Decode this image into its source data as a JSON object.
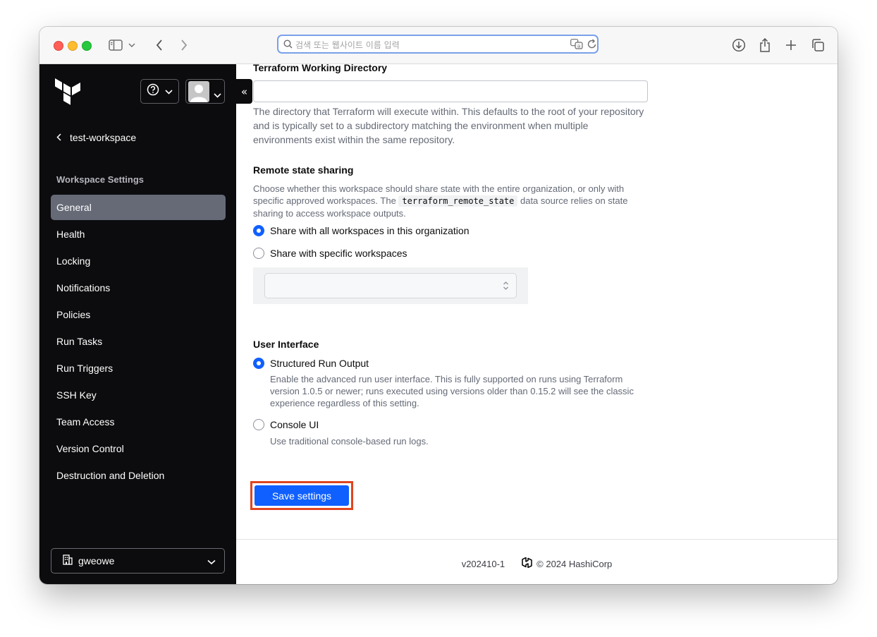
{
  "browser": {
    "url_placeholder": "검색 또는 웹사이트 이름 입력",
    "icons": [
      "sidebar-toggle-icon",
      "chevron-down-icon",
      "back-arrow-icon",
      "forward-arrow-icon",
      "search-icon",
      "translate-icon",
      "reload-icon",
      "download-icon",
      "share-icon",
      "new-tab-icon",
      "tab-overview-icon"
    ]
  },
  "sidebar": {
    "collapse_label": "«",
    "back_label": "test-workspace",
    "section_title": "Workspace Settings",
    "items": [
      {
        "label": "General",
        "active": true
      },
      {
        "label": "Health"
      },
      {
        "label": "Locking"
      },
      {
        "label": "Notifications"
      },
      {
        "label": "Policies"
      },
      {
        "label": "Run Tasks"
      },
      {
        "label": "Run Triggers"
      },
      {
        "label": "SSH Key"
      },
      {
        "label": "Team Access"
      },
      {
        "label": "Version Control"
      },
      {
        "label": "Destruction and Deletion"
      }
    ],
    "org_name": "gweowe"
  },
  "main": {
    "working_dir": {
      "label": "Terraform Working Directory",
      "value": "",
      "help": "The directory that Terraform will execute within. This defaults to the root of your repository and is typically set to a subdirectory matching the environment when multiple environments exist within the same repository."
    },
    "remote_state": {
      "label": "Remote state sharing",
      "help_before": "Choose whether this workspace should share state with the entire organization, or only with specific approved workspaces. The ",
      "help_code": "terraform_remote_state",
      "help_after": " data source relies on state sharing to access workspace outputs.",
      "option_all": "Share with all workspaces in this organization",
      "option_specific": "Share with specific workspaces",
      "selected": "all"
    },
    "user_interface": {
      "label": "User Interface",
      "option_structured": "Structured Run Output",
      "structured_help": "Enable the advanced run user interface. This is fully supported on runs using Terraform version 1.0.5 or newer; runs executed using versions older than 0.15.2 will see the classic experience regardless of this setting.",
      "option_console": "Console UI",
      "console_help": "Use traditional console-based run logs.",
      "selected": "structured"
    },
    "save_label": "Save settings"
  },
  "footer": {
    "version": "v202410-1",
    "copyright": "© 2024 HashiCorp"
  },
  "colors": {
    "sidebar_bg": "#0c0c0e",
    "active_nav_bg": "#656a76",
    "primary_button": "#1060ff",
    "highlight_border": "#e0451f",
    "url_focus_border": "#7aa0ea"
  }
}
